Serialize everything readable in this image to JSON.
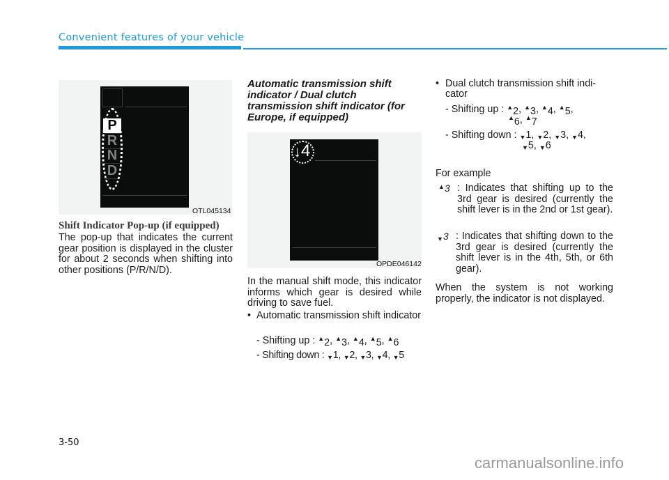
{
  "header": {
    "section_title": "Convenient features of your vehicle",
    "accent_color": "#1e9ae0"
  },
  "figure1": {
    "gears": [
      "P",
      "R",
      "N",
      "D"
    ],
    "selected_gear": "P",
    "code": "OTL045134"
  },
  "figure2": {
    "indicator_arrow": "↓",
    "indicator_gear": "4",
    "code": "OPDE046142"
  },
  "popup_section": {
    "heading": "Shift Indicator Pop-up (if equipped)",
    "body": "The pop-up that indicates the current gear position is displayed in the cluster for about 2 seconds when shifting into other positions (P/R/N/D)."
  },
  "auto_section": {
    "heading": "Automatic transmission shift indicator / Dual clutch transmission shift indicator (for Europe, if equipped)",
    "body": "In the manual shift mode, this indicator informs which gear is desired while driving to save fuel.",
    "bullet_auto": "Automatic transmission shift indicator",
    "auto_up_label": "- Shifting up :",
    "auto_up_gears": [
      "2",
      "3",
      "4",
      "5",
      "6"
    ],
    "auto_down_label": "- Shifting down :",
    "auto_down_gears": [
      "1",
      "2",
      "3",
      "4",
      "5"
    ]
  },
  "right_column": {
    "bullet_dct_line1": "Dual clutch transmission shift indi-",
    "bullet_dct_line2": "cator",
    "dct_up_label": "- Shifting up :",
    "dct_up_gears": [
      "2",
      "3",
      "4",
      "5",
      "6",
      "7"
    ],
    "dct_down_label": "- Shifting down :",
    "dct_down_gears": [
      "1",
      "2",
      "3",
      "4",
      "5",
      "6"
    ],
    "example_label": "For example",
    "example_up_symbol": "3",
    "example_up_text": ": Indicates that shifting up to the 3rd gear is desired (currently the shift lever is in the 2nd or 1st gear).",
    "example_down_symbol": "3",
    "example_down_text": ": Indicates that shifting down to the 3rd gear is desired (currently the shift lever is in the 4th, 5th, or 6th gear).",
    "not_working": "When the system is not working properly, the indicator is not displayed."
  },
  "footer": {
    "page_number": "3-50",
    "watermark": "carmanualsonline.info"
  }
}
